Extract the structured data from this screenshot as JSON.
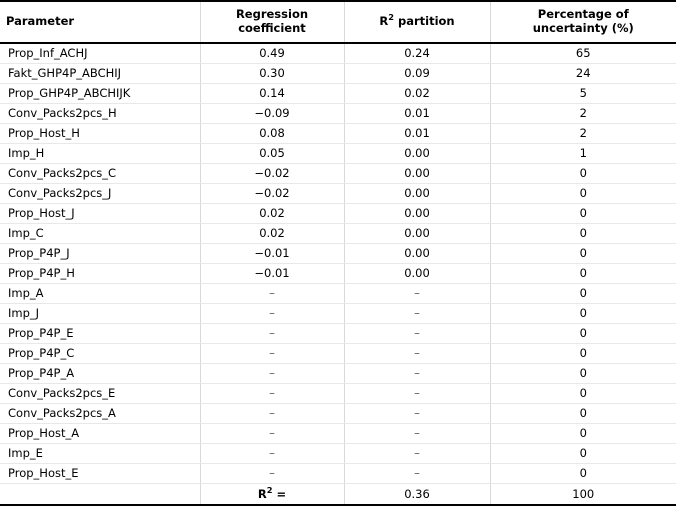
{
  "table": {
    "columns": [
      {
        "key": "parameter",
        "label": "Parameter",
        "align": "left"
      },
      {
        "key": "regression_coefficient",
        "label_line1": "Regression",
        "label_line2": "coefficient",
        "align": "center"
      },
      {
        "key": "r2_partition",
        "label_prefix": "R",
        "label_sup": "2",
        "label_suffix": " partition",
        "align": "center"
      },
      {
        "key": "percentage_uncertainty",
        "label_line1": "Percentage of",
        "label_line2": "uncertainty (%)",
        "align": "center"
      }
    ],
    "rows": [
      {
        "parameter": "Prop_Inf_ACHJ",
        "regression_coefficient": "0.49",
        "r2_partition": "0.24",
        "percentage_uncertainty": "65"
      },
      {
        "parameter": "Fakt_GHP4P_ABCHIJ",
        "regression_coefficient": "0.30",
        "r2_partition": "0.09",
        "percentage_uncertainty": "24"
      },
      {
        "parameter": "Prop_GHP4P_ABCHIJK",
        "regression_coefficient": "0.14",
        "r2_partition": "0.02",
        "percentage_uncertainty": "5"
      },
      {
        "parameter": "Conv_Packs2pcs_H",
        "regression_coefficient": "−0.09",
        "r2_partition": "0.01",
        "percentage_uncertainty": "2"
      },
      {
        "parameter": "Prop_Host_H",
        "regression_coefficient": "0.08",
        "r2_partition": "0.01",
        "percentage_uncertainty": "2"
      },
      {
        "parameter": "Imp_H",
        "regression_coefficient": "0.05",
        "r2_partition": "0.00",
        "percentage_uncertainty": "1"
      },
      {
        "parameter": "Conv_Packs2pcs_C",
        "regression_coefficient": "−0.02",
        "r2_partition": "0.00",
        "percentage_uncertainty": "0"
      },
      {
        "parameter": "Conv_Packs2pcs_J",
        "regression_coefficient": "−0.02",
        "r2_partition": "0.00",
        "percentage_uncertainty": "0"
      },
      {
        "parameter": "Prop_Host_J",
        "regression_coefficient": "0.02",
        "r2_partition": "0.00",
        "percentage_uncertainty": "0"
      },
      {
        "parameter": "Imp_C",
        "regression_coefficient": "0.02",
        "r2_partition": "0.00",
        "percentage_uncertainty": "0"
      },
      {
        "parameter": "Prop_P4P_J",
        "regression_coefficient": "−0.01",
        "r2_partition": "0.00",
        "percentage_uncertainty": "0"
      },
      {
        "parameter": "Prop_P4P_H",
        "regression_coefficient": "−0.01",
        "r2_partition": "0.00",
        "percentage_uncertainty": "0"
      },
      {
        "parameter": "Imp_A",
        "regression_coefficient": "–",
        "r2_partition": "–",
        "percentage_uncertainty": "0"
      },
      {
        "parameter": "Imp_J",
        "regression_coefficient": "–",
        "r2_partition": "–",
        "percentage_uncertainty": "0"
      },
      {
        "parameter": "Prop_P4P_E",
        "regression_coefficient": "–",
        "r2_partition": "–",
        "percentage_uncertainty": "0"
      },
      {
        "parameter": "Prop_P4P_C",
        "regression_coefficient": "–",
        "r2_partition": "–",
        "percentage_uncertainty": "0"
      },
      {
        "parameter": "Prop_P4P_A",
        "regression_coefficient": "–",
        "r2_partition": "–",
        "percentage_uncertainty": "0"
      },
      {
        "parameter": "Conv_Packs2pcs_E",
        "regression_coefficient": "–",
        "r2_partition": "–",
        "percentage_uncertainty": "0"
      },
      {
        "parameter": "Conv_Packs2pcs_A",
        "regression_coefficient": "–",
        "r2_partition": "–",
        "percentage_uncertainty": "0"
      },
      {
        "parameter": "Prop_Host_A",
        "regression_coefficient": "–",
        "r2_partition": "–",
        "percentage_uncertainty": "0"
      },
      {
        "parameter": "Imp_E",
        "regression_coefficient": "–",
        "r2_partition": "–",
        "percentage_uncertainty": "0"
      },
      {
        "parameter": "Prop_Host_E",
        "regression_coefficient": "–",
        "r2_partition": "–",
        "percentage_uncertainty": "0"
      }
    ],
    "summary_row": {
      "parameter": "",
      "label_prefix": "R",
      "label_sup": "2",
      "label_suffix": " =",
      "r2_partition": "0.36",
      "percentage_uncertainty": "100"
    }
  }
}
